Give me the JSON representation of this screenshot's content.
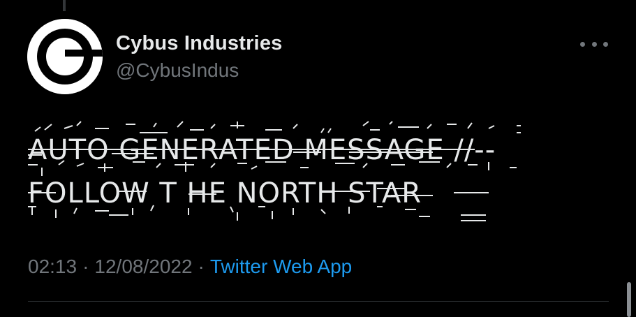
{
  "tweet": {
    "author": {
      "display_name": "Cybus Industries",
      "handle": "@CybusIndus",
      "avatar_icon": "cybus-logo-icon"
    },
    "more_icon": "more-horizontal-icon",
    "text_lines": [
      "AUTO GENERATED MESSAGE //--",
      "FOLLOW T HE NORTH STAR"
    ],
    "meta": {
      "time": "02:13",
      "separator": "·",
      "date": "12/08/2022",
      "source": "Twitter Web App"
    }
  },
  "colors": {
    "background": "#000000",
    "primary_text": "#e7e9ea",
    "secondary_text": "#71767b",
    "link": "#1d9bf0",
    "divider": "#2f3336"
  }
}
